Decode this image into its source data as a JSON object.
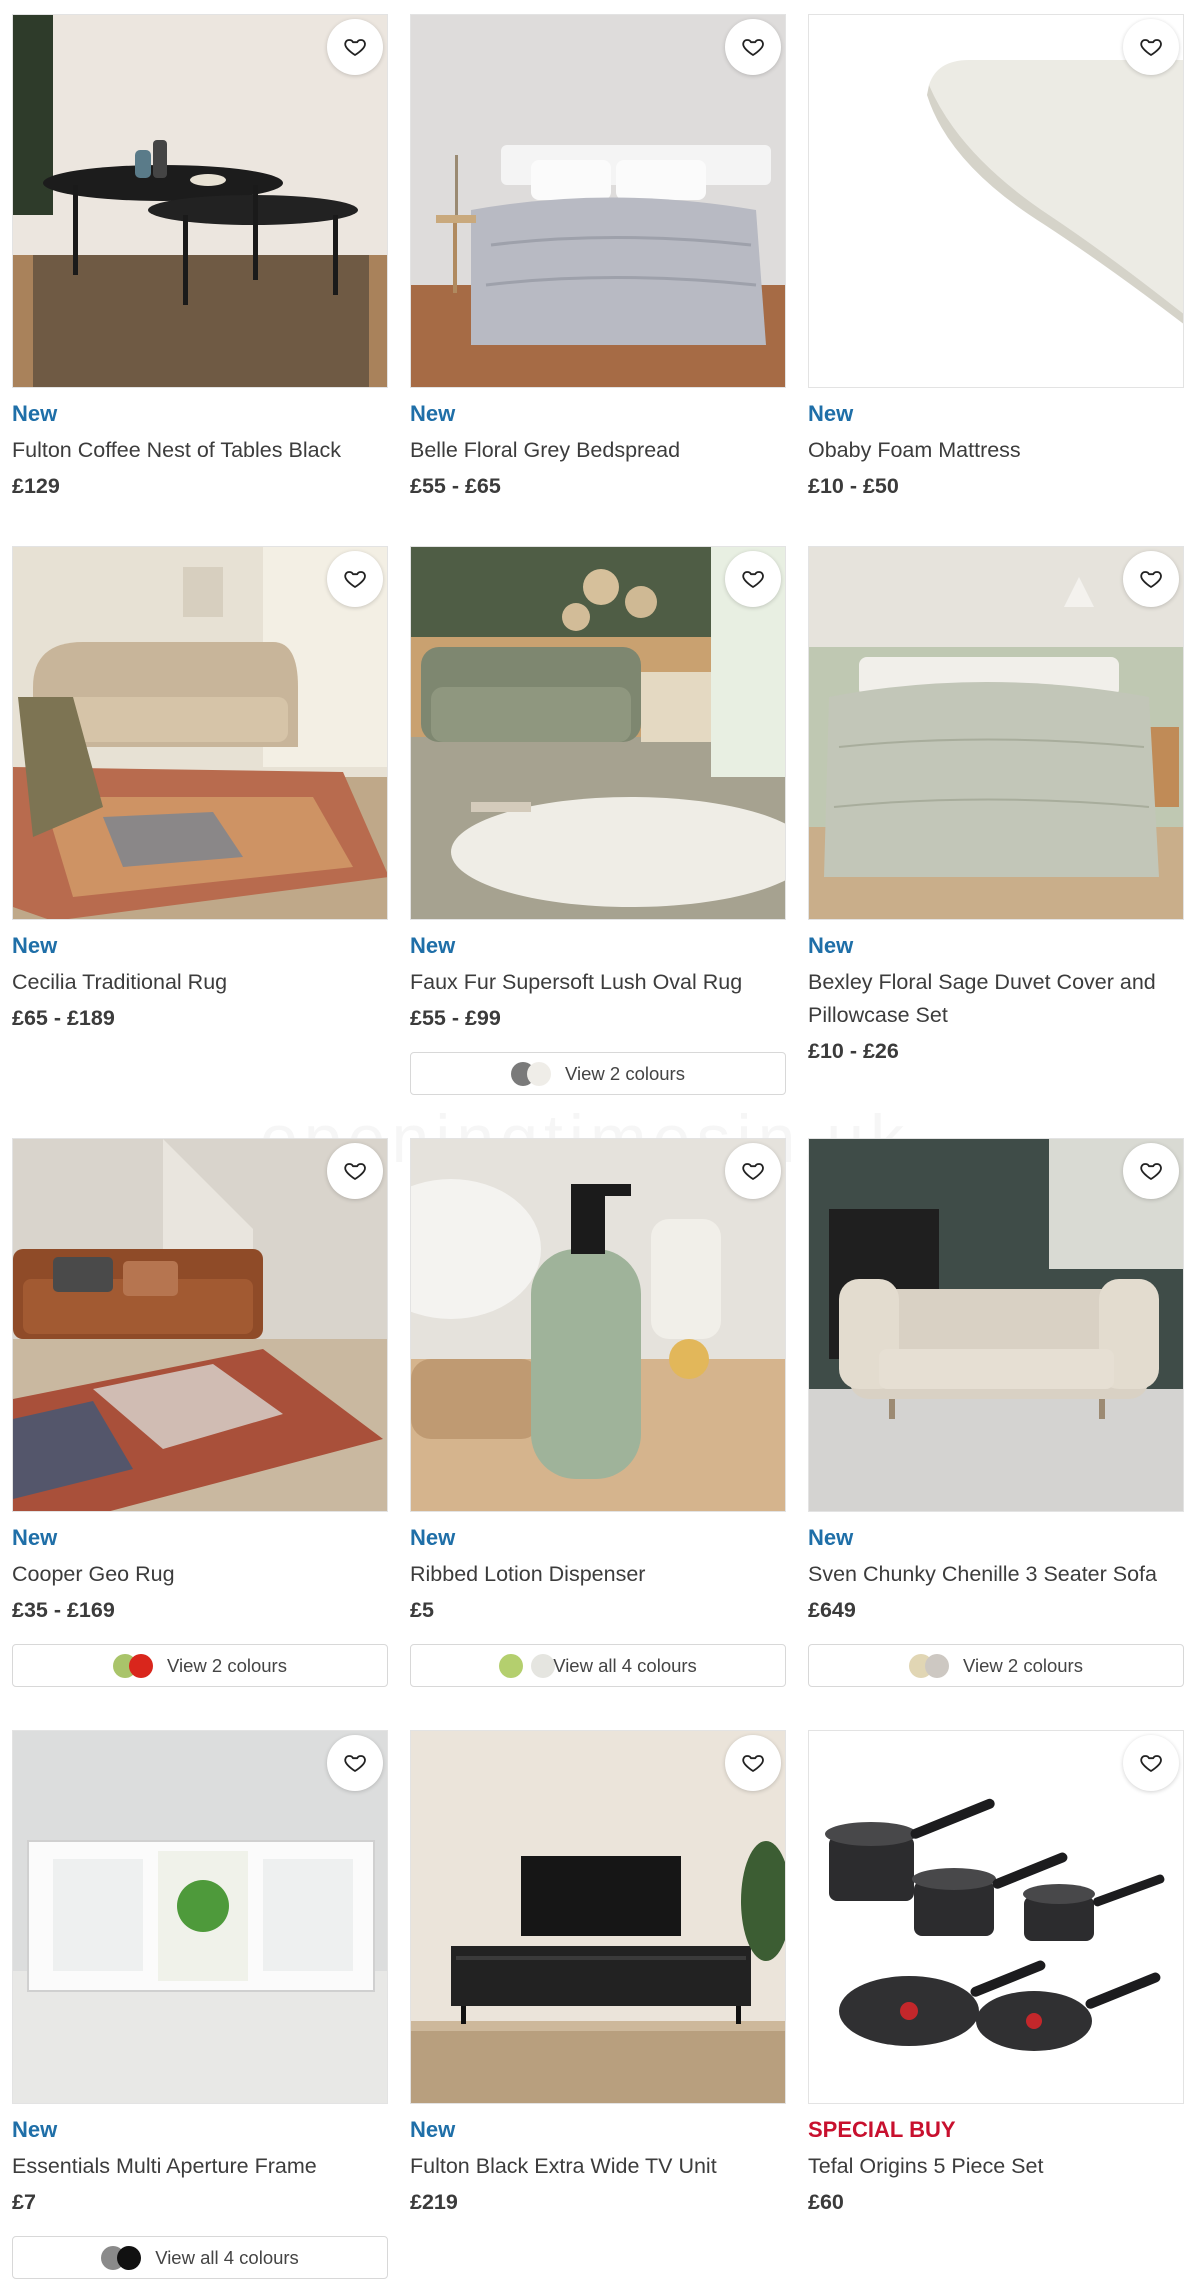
{
  "watermark": "openingtimesin.uk",
  "products": [
    {
      "badge": "New",
      "title": "Fulton Coffee Nest of Tables Black",
      "price": "£129",
      "colours": null
    },
    {
      "badge": "New",
      "title": "Belle Floral Grey Bedspread",
      "price": "£55 - £65",
      "colours": null
    },
    {
      "badge": "New",
      "title": "Obaby Foam Mattress",
      "price": "£10 - £50",
      "colours": null
    },
    {
      "badge": "New",
      "title": "Cecilia Traditional Rug",
      "price": "£65 - £189",
      "colours": null
    },
    {
      "badge": "New",
      "title": "Faux Fur Supersoft Lush Oval Rug",
      "price": "£55 - £99",
      "colours": {
        "label": "View 2 colours",
        "swatches": [
          "#7a7a7a",
          "#efede8"
        ]
      }
    },
    {
      "badge": "New",
      "title": "Bexley Floral Sage Duvet Cover and Pillowcase Set",
      "price": "£10 - £26",
      "colours": null
    },
    {
      "badge": "New",
      "title": "Cooper Geo Rug",
      "price": "£35 - £169",
      "colours": {
        "label": "View 2 colours",
        "swatches": [
          "#a9c46a",
          "#d9261c"
        ]
      }
    },
    {
      "badge": "New",
      "title": "Ribbed Lotion Dispenser",
      "price": "£5",
      "colours": {
        "label": "View all 4 colours",
        "swatches": [
          "#b4cf6e",
          "#e5e5e0"
        ]
      }
    },
    {
      "badge": "New",
      "title": "Sven Chunky Chenille 3 Seater Sofa",
      "price": "£649",
      "colours": {
        "label": "View 2 colours",
        "swatches": [
          "#e1d6b4",
          "#cdc8c2"
        ]
      }
    },
    {
      "badge": "New",
      "title": "Essentials Multi Aperture Frame",
      "price": "£7",
      "colours": {
        "label": "View all 4 colours",
        "swatches": [
          "#8a8a8a",
          "#111111"
        ]
      }
    },
    {
      "badge": "New",
      "title": "Fulton Black Extra Wide TV Unit",
      "price": "£219",
      "colours": null
    },
    {
      "badge": "SPECIAL BUY",
      "title": "Tefal Origins 5 Piece Set",
      "price": "£60",
      "colours": null
    }
  ],
  "colors": {
    "badge_new": "#1f6fa8",
    "badge_special": "#c8102e"
  }
}
